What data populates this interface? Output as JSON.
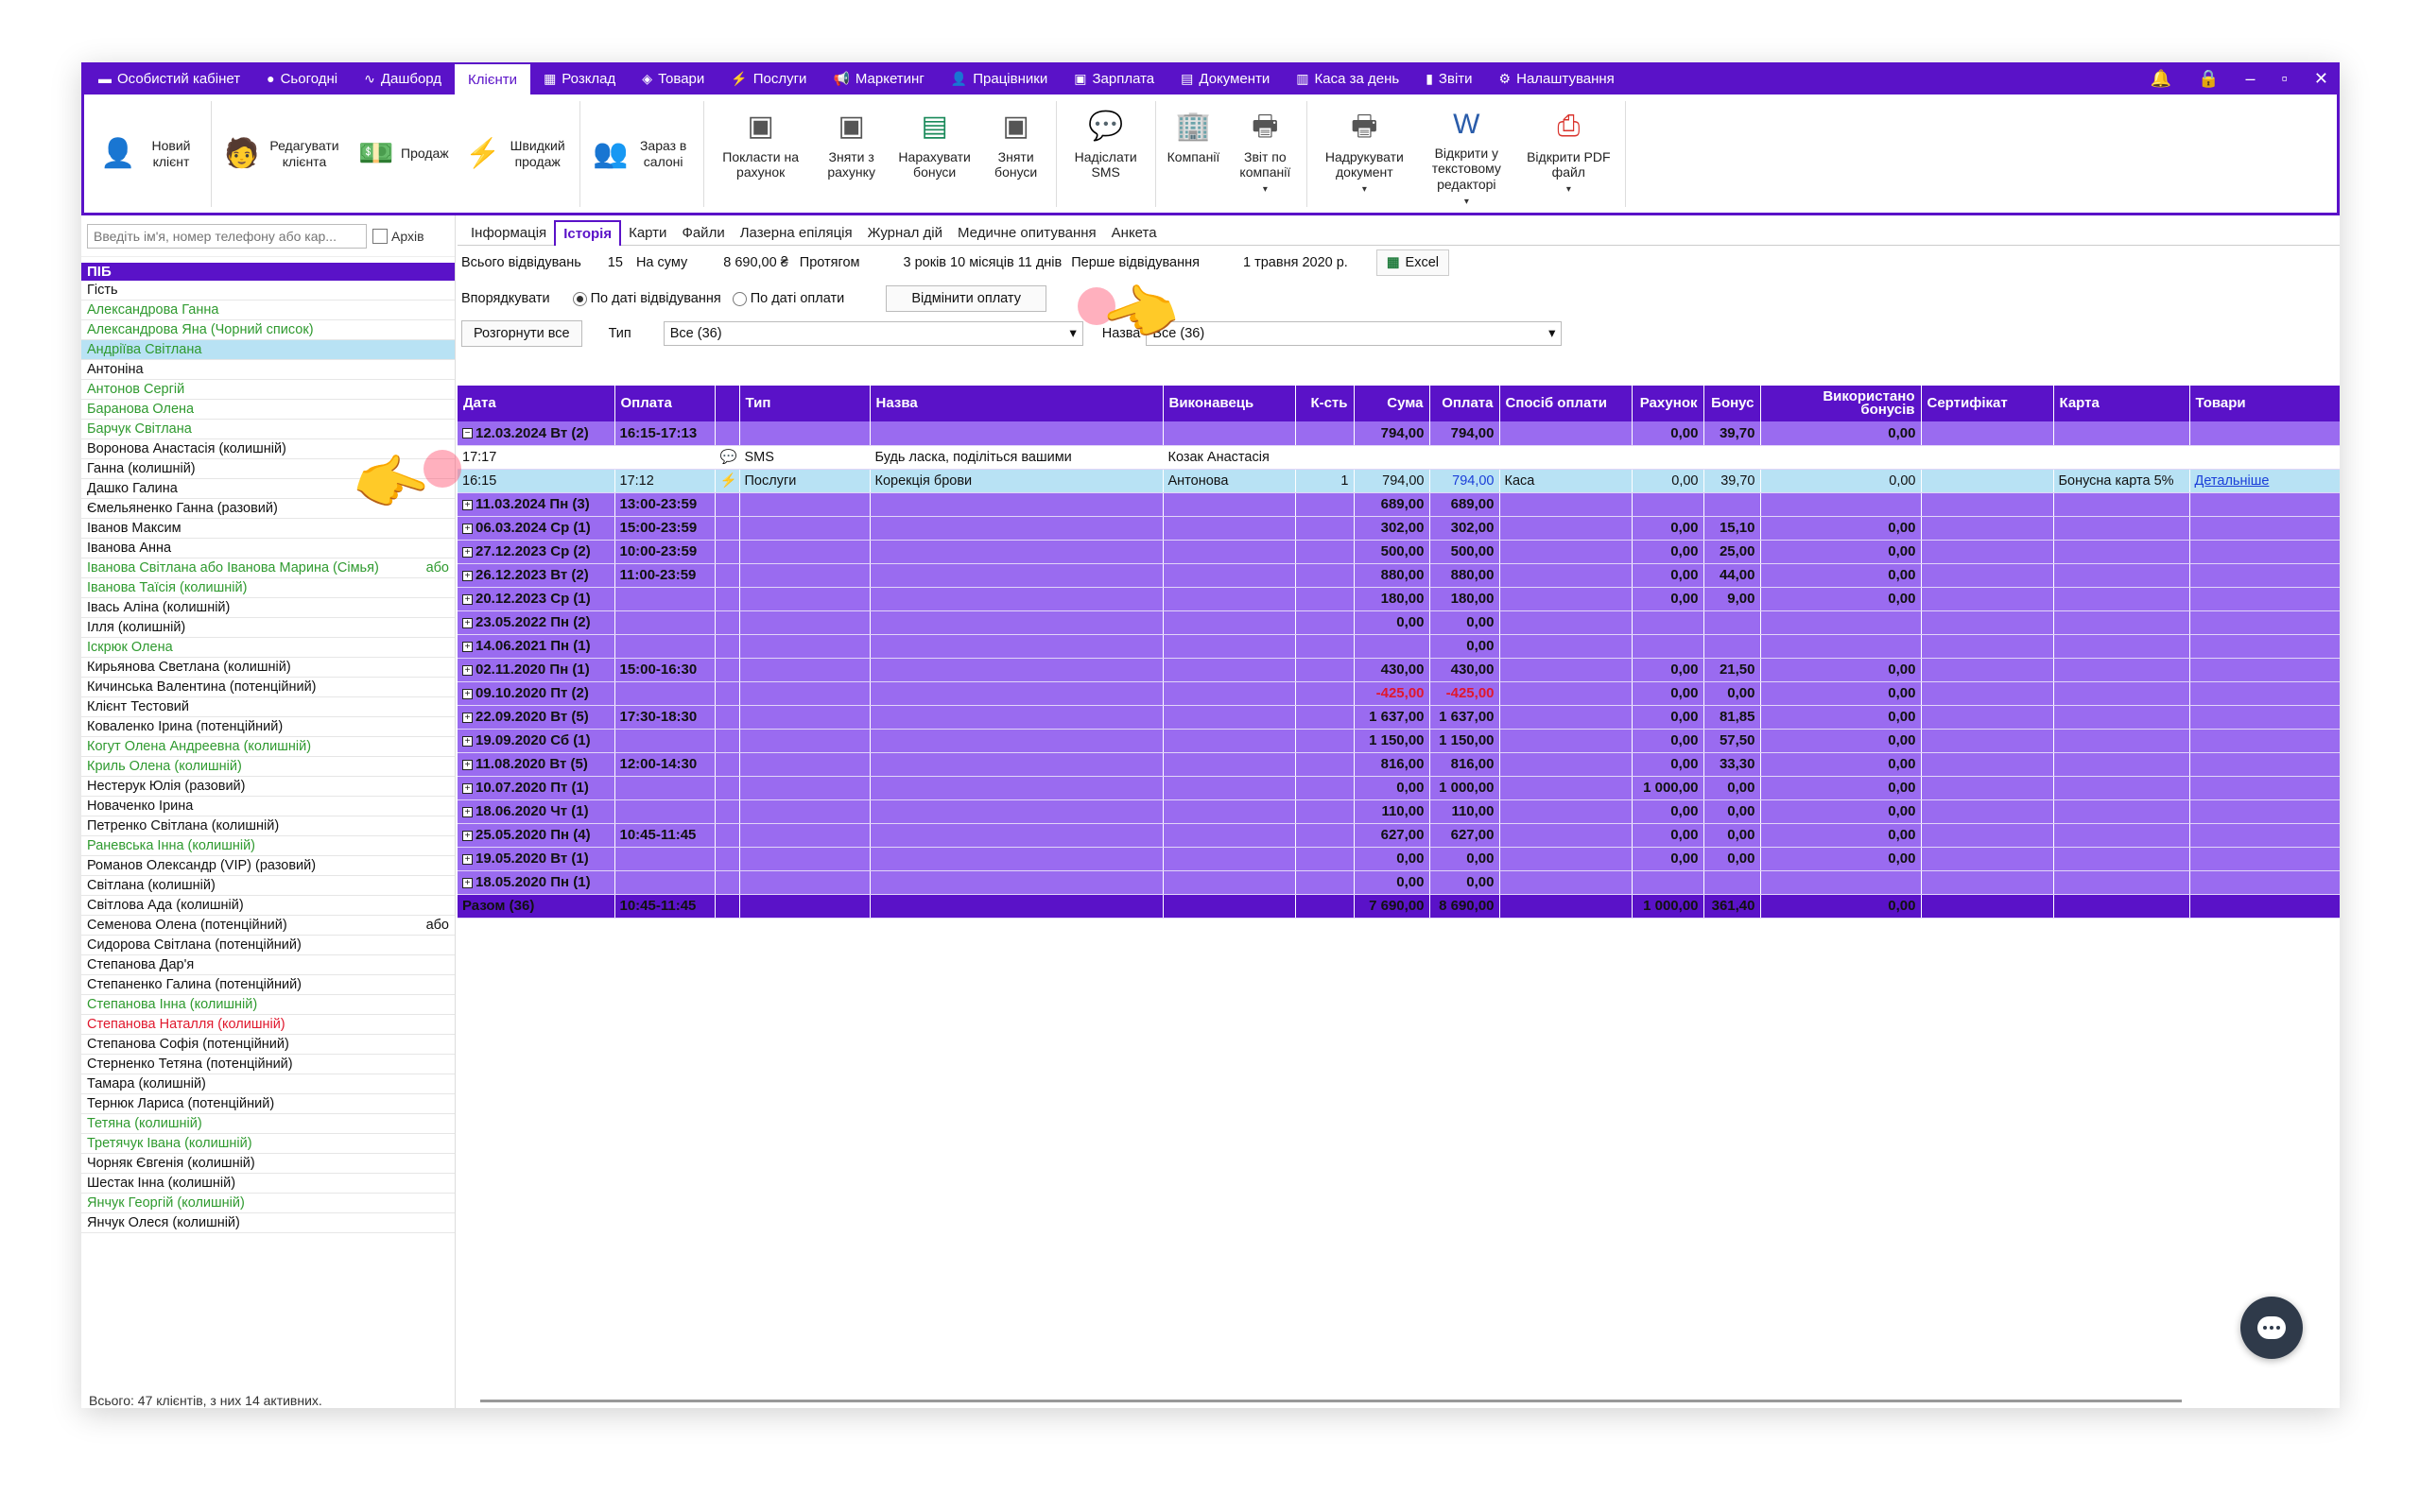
{
  "nav": {
    "items": [
      {
        "icon": "▬",
        "label": "Особистий кабінет"
      },
      {
        "icon": "●",
        "label": "Сьогодні"
      },
      {
        "icon": "∿",
        "label": "Дашборд"
      },
      {
        "icon": "",
        "label": "Клієнти",
        "active": true
      },
      {
        "icon": "▦",
        "label": "Розклад"
      },
      {
        "icon": "◈",
        "label": "Товари"
      },
      {
        "icon": "⚡",
        "label": "Послуги"
      },
      {
        "icon": "📢",
        "label": "Маркетинг"
      },
      {
        "icon": "👤",
        "label": "Працівники"
      },
      {
        "icon": "▣",
        "label": "Зарплата"
      },
      {
        "icon": "▤",
        "label": "Документи"
      },
      {
        "icon": "▥",
        "label": "Каса за день"
      },
      {
        "icon": "▮",
        "label": "Звіти"
      },
      {
        "icon": "⚙",
        "label": "Налаштування"
      }
    ]
  },
  "ribbon": {
    "new_client": "Новий клієнт",
    "edit_client": "Редагувати клієнта",
    "sale": "Продаж",
    "quick_sale": "Швидкий продаж",
    "in_salon": "Зараз в салоні",
    "put_account": "Покласти на рахунок",
    "withdraw_account": "Зняти з рахунку",
    "accrue_bonus": "Нарахувати бонуси",
    "withdraw_bonus": "Зняти бонуси",
    "send_sms": "Надіслати SMS",
    "companies": "Компанії",
    "company_report": "Звіт по компанії",
    "print_doc": "Надрукувати документ",
    "open_text": "Відкрити у текстовому редакторі",
    "open_pdf": "Відкрити PDF файл"
  },
  "left": {
    "search_placeholder": "Введіть ім'я, номер телефону або кар...",
    "archive_label": "Архів",
    "header": "ПІБ",
    "footer": "Всього: 47 клієнтів, з них 14 активних."
  },
  "clients": [
    {
      "name": "Гість",
      "color": "black"
    },
    {
      "name": "Александрова Ганна",
      "color": "green"
    },
    {
      "name": "Александрова Яна (Чорний список)",
      "color": "green"
    },
    {
      "name": "Андріїва Світлана",
      "color": "green",
      "selected": true
    },
    {
      "name": "Антоніна",
      "color": "black"
    },
    {
      "name": "Антонов Сергій",
      "color": "green"
    },
    {
      "name": "Баранова Олена",
      "color": "green"
    },
    {
      "name": "Барчук Світлана",
      "color": "green"
    },
    {
      "name": "Воронова Анастасія (колишній)",
      "color": "black"
    },
    {
      "name": "Ганна (колишній)",
      "color": "black"
    },
    {
      "name": "Дашко Галина",
      "color": "black"
    },
    {
      "name": "Ємельяненко Ганна (разовий)",
      "color": "black"
    },
    {
      "name": "Іванов Максим",
      "color": "black"
    },
    {
      "name": "Іванова Анна",
      "color": "black"
    },
    {
      "name": "Іванова Світлана  або Іванова  Марина (Сімья)",
      "color": "green",
      "extra": "або"
    },
    {
      "name": "Іванова Таїсія (колишній)",
      "color": "green"
    },
    {
      "name": "Івась Аліна (колишній)",
      "color": "black"
    },
    {
      "name": "Ілля (колишній)",
      "color": "black"
    },
    {
      "name": "Іскрюк Олена",
      "color": "green"
    },
    {
      "name": "Кирьянова Светлана (колишній)",
      "color": "black"
    },
    {
      "name": "Кичинська Валентина (потенційний)",
      "color": "black"
    },
    {
      "name": "Клієнт Тестовий",
      "color": "black"
    },
    {
      "name": "Коваленко Ірина (потенційний)",
      "color": "black"
    },
    {
      "name": "Когут Олена Андреевна (колишній)",
      "color": "green"
    },
    {
      "name": "Криль Олена (колишній)",
      "color": "green"
    },
    {
      "name": "Нестерук Юлія (разовий)",
      "color": "black"
    },
    {
      "name": "Новаченко Ірина",
      "color": "black"
    },
    {
      "name": "Петренко Світлана (колишній)",
      "color": "black"
    },
    {
      "name": "Раневська Інна (колишній)",
      "color": "green"
    },
    {
      "name": "Романов Олександр (VIP) (разовий)",
      "color": "black"
    },
    {
      "name": "Світлана (колишній)",
      "color": "black"
    },
    {
      "name": "Світлова Ада (колишній)",
      "color": "black"
    },
    {
      "name": "Семенова Олена (потенційний)",
      "color": "black",
      "extra": "або"
    },
    {
      "name": "Сидорова Світлана (потенційний)",
      "color": "black"
    },
    {
      "name": "Степанова Дар'я",
      "color": "black"
    },
    {
      "name": "Степаненко Галина (потенційний)",
      "color": "black"
    },
    {
      "name": "Степанова Інна (колишній)",
      "color": "green"
    },
    {
      "name": "Степанова Наталля (колишній)",
      "color": "red"
    },
    {
      "name": "Степанова Софія (потенційний)",
      "color": "black"
    },
    {
      "name": "Стерненко Тетяна (потенційний)",
      "color": "black"
    },
    {
      "name": "Тамара (колишній)",
      "color": "black"
    },
    {
      "name": "Тернюк Лариса (потенційний)",
      "color": "black"
    },
    {
      "name": "Тетяна (колишній)",
      "color": "green"
    },
    {
      "name": "Третячук Івана (колишній)",
      "color": "green"
    },
    {
      "name": "Чорняк Євгенія (колишній)",
      "color": "black"
    },
    {
      "name": "Шестак Інна (колишній)",
      "color": "black"
    },
    {
      "name": "Янчук Георгій (колишній)",
      "color": "green"
    },
    {
      "name": "Янчук Олеся (колишній)",
      "color": "black"
    }
  ],
  "tabs": [
    {
      "label": "Інформація"
    },
    {
      "label": "Історія",
      "active": true
    },
    {
      "label": "Карти"
    },
    {
      "label": "Файли"
    },
    {
      "label": "Лазерна епіляція"
    },
    {
      "label": "Журнал дій"
    },
    {
      "label": "Медичне опитування"
    },
    {
      "label": "Анкета"
    }
  ],
  "summary": {
    "visits_label": "Всього відвідувань",
    "visits": "15",
    "sum_label": "На суму",
    "sum": "8 690,00 ₴",
    "duration_label": "Протягом",
    "duration": "3 років 10 місяців 11 днів",
    "first_label": "Перше відвідування",
    "first": "1 травня 2020 р.",
    "excel": "Excel"
  },
  "sort": {
    "label": "Впорядкувати",
    "opt1": "По даті відвідування",
    "opt2": "По даті оплати",
    "cancel": "Відмінити оплату"
  },
  "filter": {
    "expand": "Розгорнути все",
    "type_label": "Тип",
    "type_value": "Все (36)",
    "name_label": "Назва",
    "name_value": "Все (36)"
  },
  "table": {
    "headers": [
      "Дата",
      "Оплата",
      "",
      "Тип",
      "Назва",
      "Виконавець",
      "К-сть",
      "Сума",
      "Оплата",
      "Спосіб оплати",
      "Рахунок",
      "Бонус",
      "Використано бонусів",
      "Сертифікат",
      "Карта",
      "Товари"
    ],
    "rows": [
      {
        "kind": "grp",
        "sign": "−",
        "date": "12.03.2024 Вт (2)",
        "pay": "16:15-17:13",
        "sum": "794,00",
        "paid": "794,00",
        "acc": "0,00",
        "bonus": "39,70",
        "used": "0,00"
      },
      {
        "kind": "sms",
        "date": "17:17",
        "pay": "",
        "icon": "💬",
        "type": "SMS",
        "name": "Будь ласка, поділіться вашими",
        "exec": "Козак Анастасія"
      },
      {
        "kind": "svc",
        "date": "16:15",
        "pay": "17:12",
        "icon": "⚡",
        "type": "Послуги",
        "name": "Корекція брови",
        "exec": "Антонова",
        "qty": "1",
        "sum": "794,00",
        "paid": "794,00",
        "method": "Каса",
        "acc": "0,00",
        "bonus": "39,70",
        "used": "0,00",
        "card": "Бонусна карта 5%",
        "goods": "Детальніше"
      },
      {
        "kind": "grp",
        "sign": "+",
        "date": "11.03.2024 Пн (3)",
        "pay": "13:00-23:59",
        "sum": "689,00",
        "paid": "689,00"
      },
      {
        "kind": "grp",
        "sign": "+",
        "date": "06.03.2024 Ср (1)",
        "pay": "15:00-23:59",
        "sum": "302,00",
        "paid": "302,00",
        "acc": "0,00",
        "bonus": "15,10",
        "used": "0,00"
      },
      {
        "kind": "grp",
        "sign": "+",
        "date": "27.12.2023 Ср (2)",
        "pay": "10:00-23:59",
        "sum": "500,00",
        "paid": "500,00",
        "acc": "0,00",
        "bonus": "25,00",
        "used": "0,00"
      },
      {
        "kind": "grp",
        "sign": "+",
        "date": "26.12.2023 Вт (2)",
        "pay": "11:00-23:59",
        "sum": "880,00",
        "paid": "880,00",
        "acc": "0,00",
        "bonus": "44,00",
        "used": "0,00"
      },
      {
        "kind": "grp",
        "sign": "+",
        "date": "20.12.2023 Ср (1)",
        "pay": "",
        "sum": "180,00",
        "paid": "180,00",
        "acc": "0,00",
        "bonus": "9,00",
        "used": "0,00"
      },
      {
        "kind": "grp",
        "sign": "+",
        "date": "23.05.2022 Пн (2)",
        "pay": "",
        "sum": "0,00",
        "paid": "0,00"
      },
      {
        "kind": "grp",
        "sign": "+",
        "date": "14.06.2021 Пн (1)",
        "pay": "",
        "sum": "",
        "paid": "0,00"
      },
      {
        "kind": "grp",
        "sign": "+",
        "date": "02.11.2020 Пн (1)",
        "pay": "15:00-16:30",
        "sum": "430,00",
        "paid": "430,00",
        "acc": "0,00",
        "bonus": "21,50",
        "used": "0,00"
      },
      {
        "kind": "grp",
        "sign": "+",
        "date": "09.10.2020 Пт (2)",
        "pay": "",
        "sum": "-425,00",
        "paid": "-425,00",
        "neg": true,
        "acc": "0,00",
        "bonus": "0,00",
        "used": "0,00"
      },
      {
        "kind": "grp",
        "sign": "+",
        "date": "22.09.2020 Вт (5)",
        "pay": "17:30-18:30",
        "sum": "1 637,00",
        "paid": "1 637,00",
        "acc": "0,00",
        "bonus": "81,85",
        "used": "0,00"
      },
      {
        "kind": "grp",
        "sign": "+",
        "date": "19.09.2020 Сб (1)",
        "pay": "",
        "sum": "1 150,00",
        "paid": "1 150,00",
        "acc": "0,00",
        "bonus": "57,50",
        "used": "0,00"
      },
      {
        "kind": "grp",
        "sign": "+",
        "date": "11.08.2020 Вт (5)",
        "pay": "12:00-14:30",
        "sum": "816,00",
        "paid": "816,00",
        "acc": "0,00",
        "bonus": "33,30",
        "used": "0,00"
      },
      {
        "kind": "grp",
        "sign": "+",
        "date": "10.07.2020 Пт (1)",
        "pay": "",
        "sum": "0,00",
        "paid": "1 000,00",
        "acc": "1 000,00",
        "bonus": "0,00",
        "used": "0,00"
      },
      {
        "kind": "grp",
        "sign": "+",
        "date": "18.06.2020 Чт (1)",
        "pay": "",
        "sum": "110,00",
        "paid": "110,00",
        "acc": "0,00",
        "bonus": "0,00",
        "used": "0,00"
      },
      {
        "kind": "grp",
        "sign": "+",
        "date": "25.05.2020 Пн (4)",
        "pay": "10:45-11:45",
        "sum": "627,00",
        "paid": "627,00",
        "acc": "0,00",
        "bonus": "0,00",
        "used": "0,00"
      },
      {
        "kind": "grp",
        "sign": "+",
        "date": "19.05.2020 Вт (1)",
        "pay": "",
        "sum": "0,00",
        "paid": "0,00",
        "acc": "0,00",
        "bonus": "0,00",
        "used": "0,00"
      },
      {
        "kind": "grp",
        "sign": "+",
        "date": "18.05.2020 Пн (1)",
        "pay": "",
        "sum": "0,00",
        "paid": "0,00"
      },
      {
        "kind": "tot",
        "date": "Разом (36)",
        "pay": "10:45-11:45",
        "sum": "7 690,00",
        "paid": "8 690,00",
        "acc": "1 000,00",
        "bonus": "361,40",
        "used": "0,00"
      }
    ]
  },
  "colors": {
    "accent": "#5a12c8",
    "group_row": "#9a6bf0",
    "selected_row": "#b8e2f4",
    "green_client": "#2f9a2f",
    "red": "#e0182d"
  }
}
